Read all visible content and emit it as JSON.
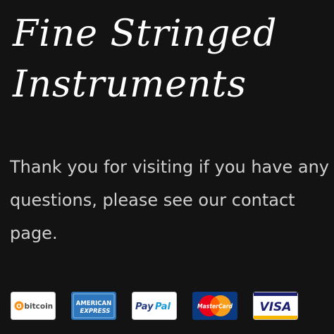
{
  "header": {
    "title_line1": "Fine Stringed",
    "title_line2": "Instruments"
  },
  "content": {
    "line1": "Thank you for visiting if you have any",
    "line2": "questions, please see our contact",
    "line3": "page."
  },
  "payments": [
    {
      "icon": "bitcoin-icon",
      "text": "bitcoin",
      "symbol": "O",
      "color": "#f7931a"
    },
    {
      "icon": "american-express-icon",
      "text_top": "AMERICAN",
      "text_bottom": "EXPRESS",
      "color": "#2e77bc"
    },
    {
      "icon": "paypal-icon",
      "text_pay": "Pay",
      "text_pal": "Pal",
      "color_pay": "#253b80",
      "color_pal": "#179bd7"
    },
    {
      "icon": "mastercard-icon",
      "text": "MasterCard",
      "color_red": "#eb001b",
      "color_orange": "#f79e1b",
      "color_bg": "#0a3a82"
    },
    {
      "icon": "visa-icon",
      "text": "VISA",
      "color": "#1a1f71",
      "color_accent": "#f7b600"
    }
  ],
  "colors": {
    "background": "#131313",
    "title": "#ffffff",
    "body_text": "#cfcfcf"
  }
}
